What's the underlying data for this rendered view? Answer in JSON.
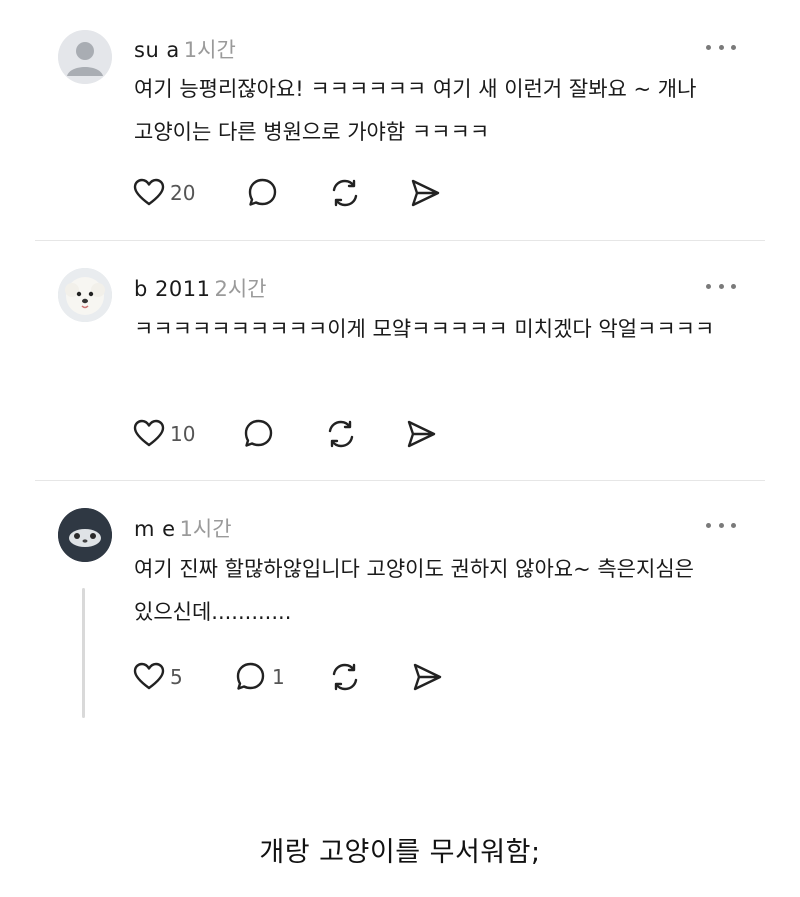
{
  "comments": [
    {
      "username": "su                     a",
      "time": "1시간",
      "text": "여기 능평리잖아요! ㅋㅋㅋㅋㅋㅋ 여기 새 이런거 잘봐요 ~ 개나 고양이는 다른 병원으로 가야함 ㅋㅋㅋㅋ",
      "likes": "20",
      "replies": "",
      "avatar": "default-profile"
    },
    {
      "username": "b          2011",
      "time": "2시간",
      "text": "ㅋㅋㅋㅋㅋㅋㅋㅋㅋㅋ이게 모얔ㅋㅋㅋㅋㅋ 미치겠다 악얼ㅋㅋㅋㅋ",
      "likes": "10",
      "replies": "",
      "avatar": "white-dog"
    },
    {
      "username": "m                  e",
      "time": "1시간",
      "text": "여기 진짜 할많하않입니다 고양이도 권하지 않아요~ 측은지심은 있으신데............",
      "likes": "5",
      "replies": "1",
      "avatar": "animal-photo"
    }
  ],
  "caption": "개랑 고양이를 무서워함;",
  "icons": [
    "heart-icon",
    "comment-icon",
    "repost-icon",
    "share-icon",
    "more-icon"
  ]
}
